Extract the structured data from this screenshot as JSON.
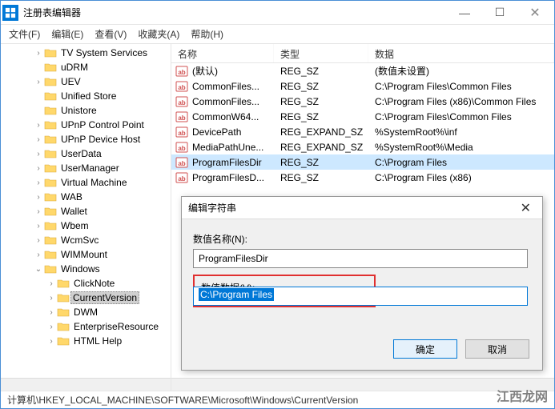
{
  "window": {
    "title": "注册表编辑器"
  },
  "menu": {
    "file": "文件(F)",
    "edit": "编辑(E)",
    "view": "查看(V)",
    "favorites": "收藏夹(A)",
    "help": "帮助(H)"
  },
  "tree_items": [
    {
      "indent": 2,
      "twisty": ">",
      "label": "TV System Services"
    },
    {
      "indent": 2,
      "twisty": "",
      "label": "uDRM"
    },
    {
      "indent": 2,
      "twisty": ">",
      "label": "UEV"
    },
    {
      "indent": 2,
      "twisty": "",
      "label": "Unified Store"
    },
    {
      "indent": 2,
      "twisty": "",
      "label": "Unistore"
    },
    {
      "indent": 2,
      "twisty": ">",
      "label": "UPnP Control Point"
    },
    {
      "indent": 2,
      "twisty": ">",
      "label": "UPnP Device Host"
    },
    {
      "indent": 2,
      "twisty": ">",
      "label": "UserData"
    },
    {
      "indent": 2,
      "twisty": ">",
      "label": "UserManager"
    },
    {
      "indent": 2,
      "twisty": ">",
      "label": "Virtual Machine"
    },
    {
      "indent": 2,
      "twisty": ">",
      "label": "WAB"
    },
    {
      "indent": 2,
      "twisty": ">",
      "label": "Wallet"
    },
    {
      "indent": 2,
      "twisty": ">",
      "label": "Wbem"
    },
    {
      "indent": 2,
      "twisty": ">",
      "label": "WcmSvc"
    },
    {
      "indent": 2,
      "twisty": ">",
      "label": "WIMMount"
    },
    {
      "indent": 2,
      "twisty": "v",
      "label": "Windows"
    },
    {
      "indent": 3,
      "twisty": ">",
      "label": "ClickNote"
    },
    {
      "indent": 3,
      "twisty": ">",
      "label": "CurrentVersion",
      "selected": true
    },
    {
      "indent": 3,
      "twisty": ">",
      "label": "DWM"
    },
    {
      "indent": 3,
      "twisty": ">",
      "label": "EnterpriseResource"
    },
    {
      "indent": 3,
      "twisty": ">",
      "label": "HTML Help"
    }
  ],
  "list_headers": {
    "name": "名称",
    "type": "类型",
    "data": "数据"
  },
  "list_rows": [
    {
      "icon": "string",
      "name": "(默认)",
      "type": "REG_SZ",
      "data": "(数值未设置)"
    },
    {
      "icon": "string",
      "name": "CommonFiles...",
      "type": "REG_SZ",
      "data": "C:\\Program Files\\Common Files"
    },
    {
      "icon": "string",
      "name": "CommonFiles...",
      "type": "REG_SZ",
      "data": "C:\\Program Files (x86)\\Common Files"
    },
    {
      "icon": "string",
      "name": "CommonW64...",
      "type": "REG_SZ",
      "data": "C:\\Program Files\\Common Files"
    },
    {
      "icon": "string",
      "name": "DevicePath",
      "type": "REG_EXPAND_SZ",
      "data": "%SystemRoot%\\inf"
    },
    {
      "icon": "string",
      "name": "MediaPathUne...",
      "type": "REG_EXPAND_SZ",
      "data": "%SystemRoot%\\Media"
    },
    {
      "icon": "string",
      "name": "ProgramFilesDir",
      "type": "REG_SZ",
      "data": "C:\\Program Files",
      "selected": true
    },
    {
      "icon": "string",
      "name": "ProgramFilesD...",
      "type": "REG_SZ",
      "data": "C:\\Program Files (x86)"
    }
  ],
  "dialog": {
    "title": "编辑字符串",
    "name_label": "数值名称(N):",
    "name_value": "ProgramFilesDir",
    "data_label": "数值数据(V):",
    "data_value": "C:\\Program Files",
    "ok": "确定",
    "cancel": "取消"
  },
  "statusbar": "计算机\\HKEY_LOCAL_MACHINE\\SOFTWARE\\Microsoft\\Windows\\CurrentVersion",
  "watermark": "江西龙网"
}
